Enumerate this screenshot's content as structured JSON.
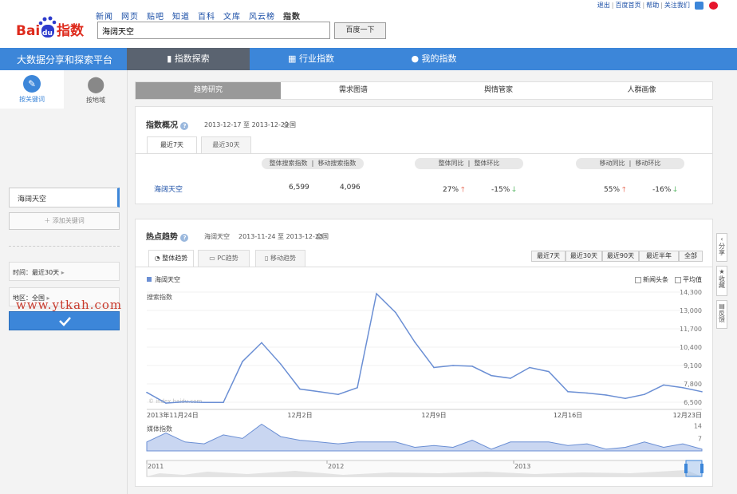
{
  "header": {
    "logo_text_bai": "Bai",
    "logo_text_du": "du",
    "logo_text_zhishu": "指数",
    "nav": [
      "新闻",
      "网页",
      "贴吧",
      "知道",
      "百科",
      "文库",
      "风云榜",
      "指数"
    ],
    "search_value": "海阔天空",
    "search_button": "百度一下",
    "top_links": [
      "退出",
      "百度首页",
      "帮助",
      "关注我们"
    ]
  },
  "mainbar": {
    "title": "大数据分享和探索平台",
    "tabs": [
      "指数探索",
      "行业指数",
      "我的指数"
    ],
    "active_tab": 0
  },
  "sidebar": {
    "tabs": [
      "按关键词",
      "按地域"
    ],
    "keyword": "海阔天空",
    "add_keyword": "添加关键词",
    "time_filter": "时间：最近30天",
    "region_filter": "地区：全国",
    "watermark": "www.ytkah.com"
  },
  "content_tabs": [
    "趋势研究",
    "需求图谱",
    "舆情管家",
    "人群画像"
  ],
  "overview": {
    "title": "指数概况",
    "date_range": "2013-12-17 至 2013-12-23",
    "region": "全国",
    "subtabs": [
      "最近7天",
      "最近30天"
    ],
    "pills": {
      "overall_mobile": [
        "整体搜索指数",
        "移动搜索指数"
      ],
      "yoy": [
        "整体同比",
        "整体环比"
      ],
      "mobile_ratio": [
        "移动同比",
        "移动环比"
      ]
    },
    "keyword": "海阔天空",
    "overall_index": "6,599",
    "mobile_index": "4,096",
    "overall_yoy": "27%",
    "overall_mom": "-15%",
    "mobile_yoy": "55%",
    "mobile_mom": "-16%"
  },
  "trend": {
    "title": "热点趋势",
    "keyword": "海阔天空",
    "date_range": "2013-11-24 至 2013-12-23",
    "region": "全国",
    "subtabs": [
      "整体趋势",
      "PC趋势",
      "移动趋势"
    ],
    "range_buttons": [
      "最近7天",
      "最近30天",
      "最近90天",
      "最近半年",
      "全部"
    ],
    "legend_label": "海阔天空",
    "checkboxes": [
      "新闻头条",
      "平均值"
    ],
    "search_label": "搜索指数",
    "media_label": "媒体指数",
    "watermark": "© index.baidu.com",
    "series_color": "#6b8fd4"
  },
  "floating_tools": [
    "分享",
    "收藏",
    "反馈"
  ],
  "chart_data": [
    {
      "type": "line",
      "title": "",
      "ylabel": "搜索指数",
      "x_ticks": [
        "2013年11月24日",
        "12月2日",
        "12月9日",
        "12月16日",
        "12月23日"
      ],
      "y_ticks": [
        "14,300",
        "13,000",
        "11,700",
        "10,400",
        "9,100",
        "7,800",
        "6,500"
      ],
      "ylim": [
        5800,
        14600
      ],
      "x": [
        "11-24",
        "11-25",
        "11-26",
        "11-27",
        "11-28",
        "11-29",
        "11-30",
        "12-01",
        "12-02",
        "12-03",
        "12-04",
        "12-05",
        "12-06",
        "12-07",
        "12-08",
        "12-09",
        "12-10",
        "12-11",
        "12-12",
        "12-13",
        "12-14",
        "12-15",
        "12-16",
        "12-17",
        "12-18",
        "12-19",
        "12-20",
        "12-21",
        "12-22",
        "12-23"
      ],
      "values": [
        6950,
        6150,
        6250,
        6200,
        6200,
        9250,
        10650,
        9050,
        7200,
        7000,
        6800,
        7300,
        14300,
        12900,
        10700,
        8800,
        8950,
        8900,
        8200,
        8000,
        8800,
        8500,
        7000,
        6900,
        6750,
        6500,
        6800,
        7500,
        7300,
        7000
      ],
      "series_name": "海阔天空"
    },
    {
      "type": "area",
      "ylabel": "媒体指数",
      "y_ticks": [
        "14",
        "7"
      ],
      "ylim": [
        0,
        17
      ],
      "values": [
        5,
        10,
        5,
        4,
        9,
        7,
        15,
        8,
        6,
        5,
        4,
        5,
        5,
        5,
        2,
        3,
        2,
        6,
        1,
        5,
        5,
        5,
        3,
        4,
        1,
        2,
        5,
        2,
        4,
        1
      ]
    },
    {
      "type": "area",
      "title": "",
      "x_ticks": [
        "2011",
        "2012",
        "2013"
      ]
    }
  ]
}
